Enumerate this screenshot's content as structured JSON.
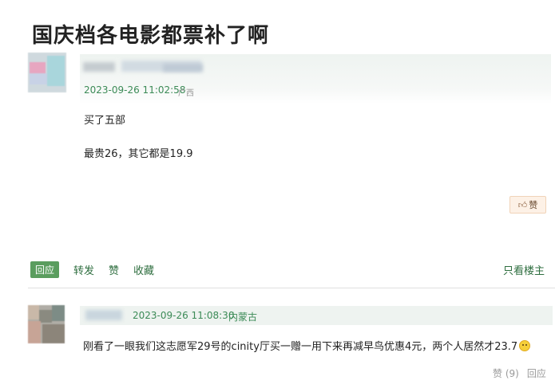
{
  "thread": {
    "title": "国庆档各电影都票补了啊"
  },
  "post1": {
    "timestamp": "2023-09-26 11:02:58",
    "location": "广西",
    "lines": [
      "买了五部",
      "最贵26，其它都是19.9"
    ],
    "like_label": "赞",
    "like_icon": "thumbs-up-icon"
  },
  "actions": {
    "reply": "回应",
    "forward": "转发",
    "like": "赞",
    "collect": "收藏",
    "only_host": "只看楼主"
  },
  "post2": {
    "timestamp": "2023-09-26 11:08:30",
    "location": "内蒙古",
    "text": "刚看了一眼我们这志愿军29号的cinity厅买一赠一用下来再减早鸟优惠4元，两个人居然才23.7",
    "emoji": "smiley-icon",
    "like_count": "赞 (9)",
    "reply": "回应"
  },
  "colors": {
    "accent_green": "#3c8b57",
    "reply_button_bg": "#5a9d5e",
    "like_button_bg": "#fdf1e6"
  }
}
